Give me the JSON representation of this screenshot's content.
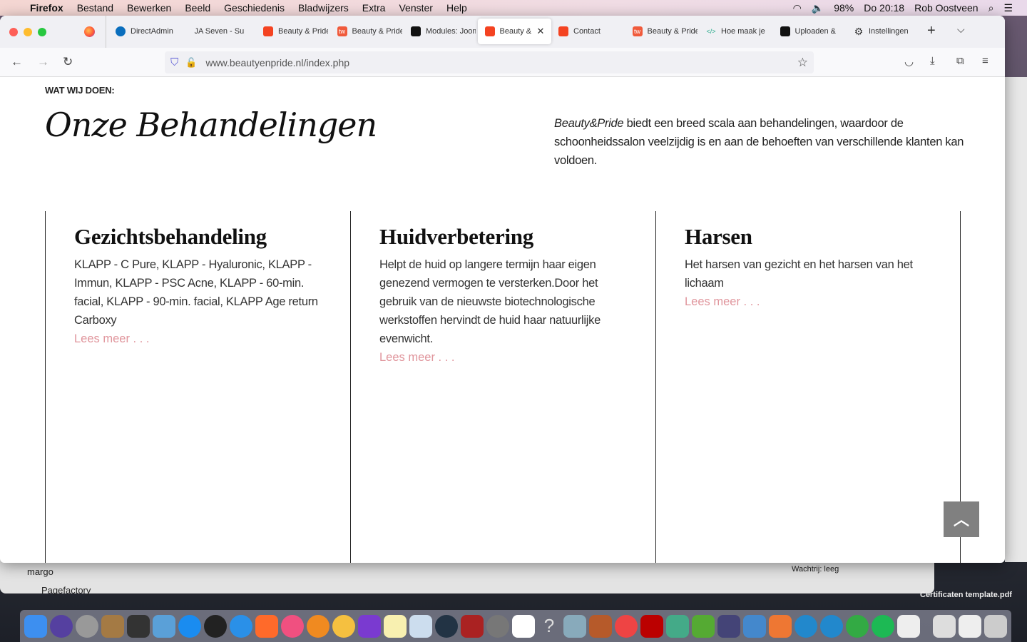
{
  "menubar": {
    "app": "Firefox",
    "items": [
      "Bestand",
      "Bewerken",
      "Beeld",
      "Geschiedenis",
      "Bladwijzers",
      "Extra",
      "Venster",
      "Help"
    ],
    "battery": "98%",
    "clock": "Do 20:18",
    "user": "Rob Oostveen"
  },
  "tabs": [
    {
      "label": "DirectAdmin",
      "icon": "directadmin-icon",
      "color": "#0a6ebd"
    },
    {
      "label": "JA Seven - Support",
      "icon": "",
      "color": ""
    },
    {
      "label": "Beauty & Pride",
      "icon": "joomla-icon",
      "color": "#f44321"
    },
    {
      "label": "Beauty & Pride",
      "icon": "tw-icon",
      "color": "#f05a3b"
    },
    {
      "label": "Modules: Joomla",
      "icon": "joomla-black-icon",
      "color": "#111"
    },
    {
      "label": "Beauty & Pride",
      "icon": "joomla-icon",
      "color": "#f44321",
      "active": true
    },
    {
      "label": "Contact",
      "icon": "joomla-icon",
      "color": "#f44321"
    },
    {
      "label": "Beauty & Pride",
      "icon": "tw-icon",
      "color": "#f05a3b"
    },
    {
      "label": "Hoe maak je",
      "icon": "code-icon",
      "color": "#2a8"
    },
    {
      "label": "Uploaden &",
      "icon": "joomla-black-icon",
      "color": "#111"
    },
    {
      "label": "Instellingen",
      "icon": "gear-icon",
      "color": "#333"
    }
  ],
  "url": {
    "host": "www.beautyenpride.nl",
    "path": "/index.php"
  },
  "page": {
    "eyebrow": "WAT WIJ DOEN:",
    "title": "Onze Behandelingen",
    "intro_brand": "Beauty&Pride",
    "intro_text": " biedt een breed scala aan behandelingen, waardoor de schoonheidssalon veelzijdig is en aan de behoeften van verschillende klanten kan voldoen.",
    "columns": [
      {
        "title": "Gezichtsbehandeling",
        "text": "KLAPP - C Pure, KLAPP - Hyaluronic, KLAPP - Immun, KLAPP - PSC Acne, KLAPP - 60-min. facial, KLAPP - 90-min. facial, KLAPP Age return Carboxy",
        "link": "Lees meer . . ."
      },
      {
        "title": "Huidverbetering",
        "text": "Helpt de huid op langere termijn haar eigen genezend vermogen te versterken.Door het gebruik van de nieuwste biotechnologische werkstoffen hervindt de huid haar natuurlijke evenwicht.",
        "link": "Lees meer . . ."
      },
      {
        "title": "Harsen",
        "text": "Het harsen van gezicht en het harsen van het lichaam",
        "link": "Lees meer . . ."
      }
    ],
    "link_color": "#e0959c"
  },
  "background": {
    "items": [
      "margo",
      "Pagefactory"
    ],
    "queue": "Wachtrij: leeg",
    "desktop_file": "Certificaten template.pdf"
  }
}
